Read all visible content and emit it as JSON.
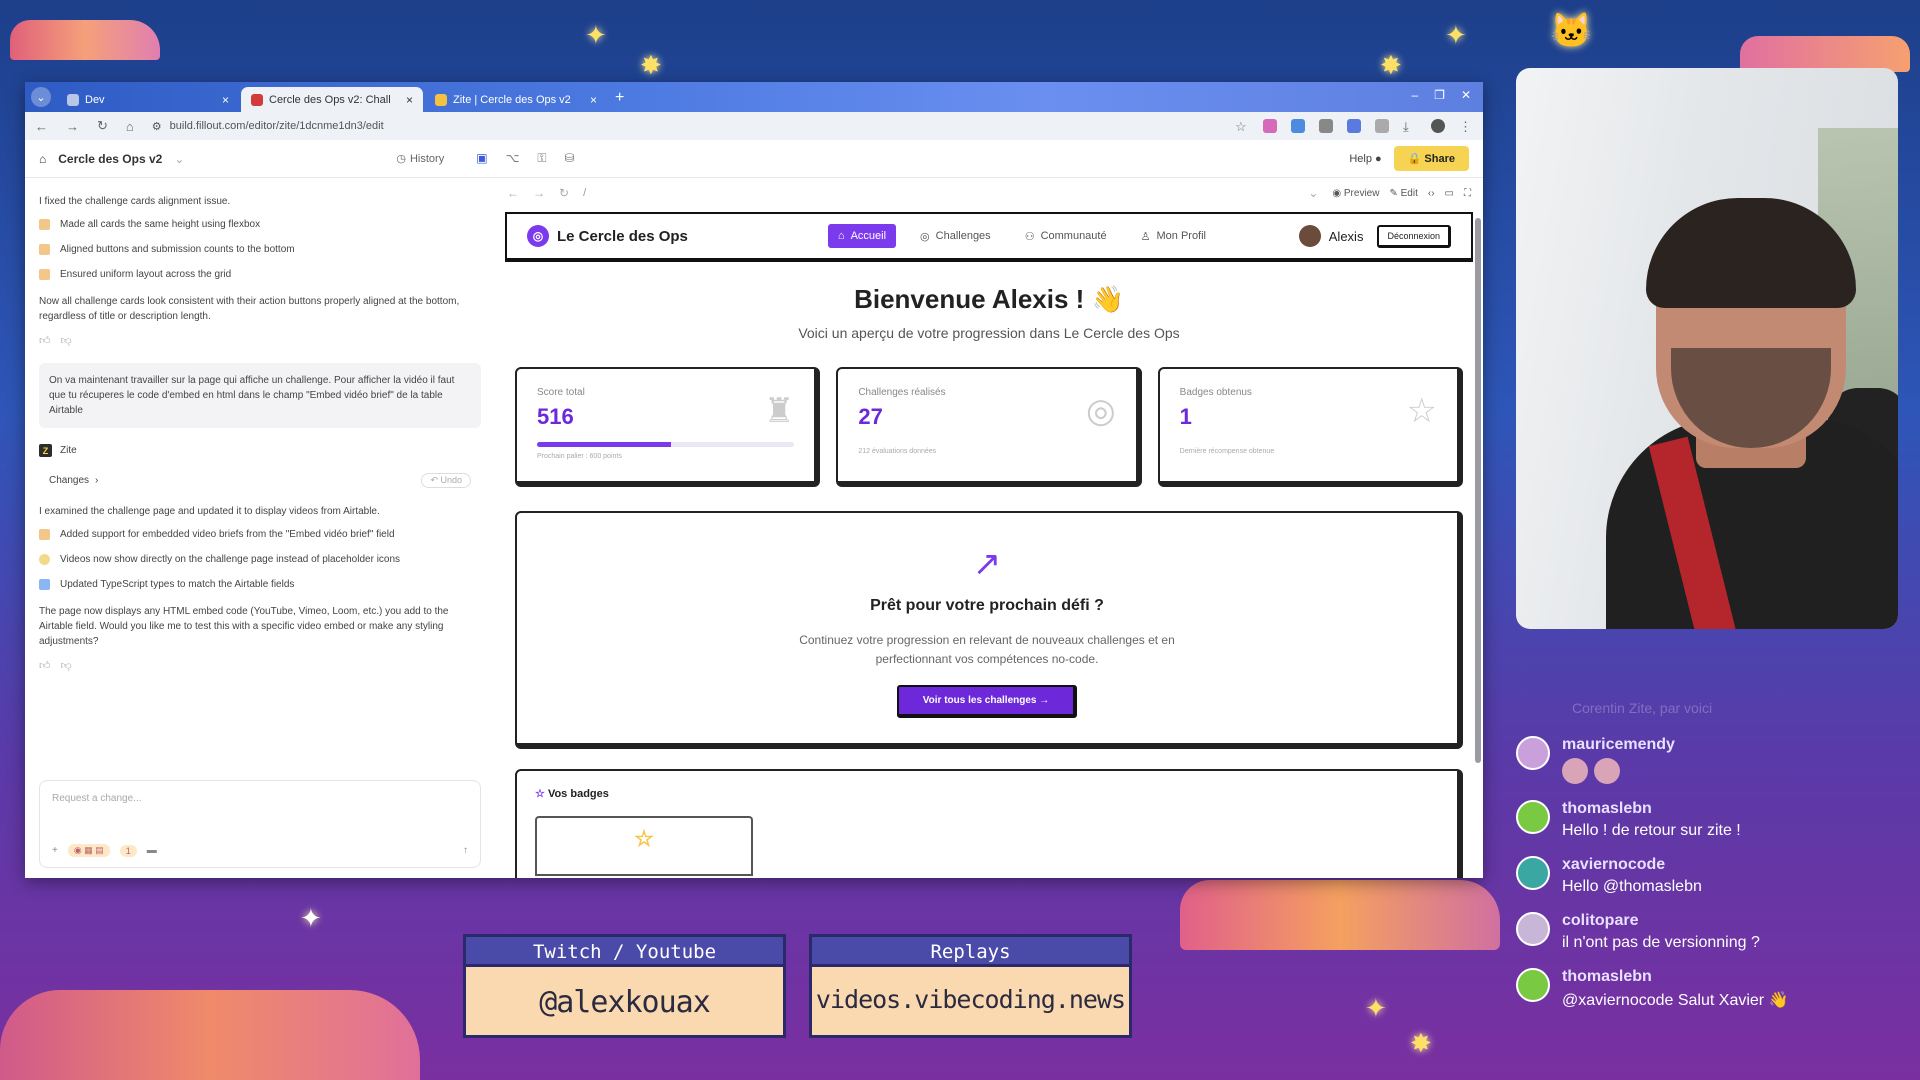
{
  "browser": {
    "tabs": [
      {
        "label": "Dev",
        "active": false,
        "fav_color": "#b8c6e8"
      },
      {
        "label": "Cercle des Ops v2: Chall",
        "active": true,
        "fav_color": "#d33b3b"
      },
      {
        "label": "Zite | Cercle des Ops v2",
        "active": false,
        "fav_color": "#f3c242"
      }
    ],
    "url": "build.fillout.com/editor/zite/1dcnme1dn3/edit"
  },
  "app": {
    "project": "Cercle des Ops v2",
    "history_label": "History",
    "help_label": "Help",
    "share_label": "Share"
  },
  "chat": {
    "intro": "I fixed the challenge cards alignment issue.",
    "items1": [
      {
        "text": "Made all cards the same height using flexbox",
        "color": "#f3c68a"
      },
      {
        "text": "Aligned buttons and submission counts to the bottom",
        "color": "#f3c68a"
      },
      {
        "text": "Ensured uniform layout across the grid",
        "color": "#f3c68a"
      }
    ],
    "summary1": "Now all challenge cards look consistent with their action buttons properly aligned at the bottom, regardless of title or description length.",
    "user_msg": "On va maintenant travailler sur la page qui affiche un challenge. Pour afficher la vidéo il faut que tu récuperes le code d'embed en html dans le champ \"Embed vidéo brief\" de la table Airtable",
    "agent_name": "Zite",
    "changes_label": "Changes",
    "undo_label": "Undo",
    "intro2": "I examined the challenge page and updated it to display videos from Airtable.",
    "items2": [
      {
        "text": "Added support for embedded video briefs from the \"Embed vidéo brief\" field",
        "color": "#f3c68a"
      },
      {
        "text": "Videos now show directly on the challenge page instead of placeholder icons",
        "color": "#f3d98a"
      },
      {
        "text": "Updated TypeScript types to match the Airtable fields",
        "color": "#8ab6f3"
      }
    ],
    "summary2": "The page now displays any HTML embed code (YouTube, Vimeo, Loom, etc.) you add to the Airtable field. Would you like me to test this with a specific video embed or make any styling adjustments?",
    "input_placeholder": "Request a change...",
    "pill_count": "1"
  },
  "preview": {
    "path": "/",
    "preview_label": "Preview",
    "edit_label": "Edit"
  },
  "site": {
    "brand": "Le Cercle des Ops",
    "nav": [
      {
        "label": "Accueil",
        "icon": "⌂",
        "active": true
      },
      {
        "label": "Challenges",
        "icon": "◎",
        "active": false
      },
      {
        "label": "Communauté",
        "icon": "⚇",
        "active": false
      },
      {
        "label": "Mon Profil",
        "icon": "♙",
        "active": false
      }
    ],
    "user_name": "Alexis",
    "logout_label": "Déconnexion",
    "welcome": "Bienvenue Alexis ! 👋",
    "subtitle": "Voici un aperçu de votre progression dans Le Cercle des Ops",
    "stats": [
      {
        "label": "Score total",
        "value": "516",
        "note": "Prochain palier : 600 points",
        "icon": "🏆",
        "progress": 0.52
      },
      {
        "label": "Challenges réalisés",
        "value": "27",
        "note": "212 évaluations données",
        "icon": "◎"
      },
      {
        "label": "Badges obtenus",
        "value": "1",
        "note": "Dernière récompense obtenue",
        "icon": "☆"
      }
    ],
    "next_title": "Prêt pour votre prochain défi ?",
    "next_text": "Continuez votre progression en relevant de nouveaux challenges et en perfectionnant vos compétences no-code.",
    "cta_label": "Voir tous les challenges →",
    "badges_title": "Vos badges"
  },
  "stream_chat": {
    "faded": "Corentin Zite, par voici",
    "messages": [
      {
        "user": "mauricemendy",
        "text": "",
        "emotes": true,
        "color": "#c9a0dc"
      },
      {
        "user": "thomaslebn",
        "text": "Hello ! de retour sur zite !",
        "color": "#7ac943"
      },
      {
        "user": "xaviernocode",
        "text": "Hello @thomaslebn",
        "color": "#3aa7a3"
      },
      {
        "user": "colitopare",
        "text": "il n'ont pas de versionning ?",
        "color": "#c8b6d8"
      },
      {
        "user": "thomaslebn",
        "text": "@xaviernocode Salut Xavier 👋",
        "color": "#7ac943"
      }
    ]
  },
  "overlay": {
    "panel1_title": "Twitch / Youtube",
    "panel1_value": "@alexkouax",
    "panel2_title": "Replays",
    "panel2_value": "videos.vibecoding.news"
  }
}
